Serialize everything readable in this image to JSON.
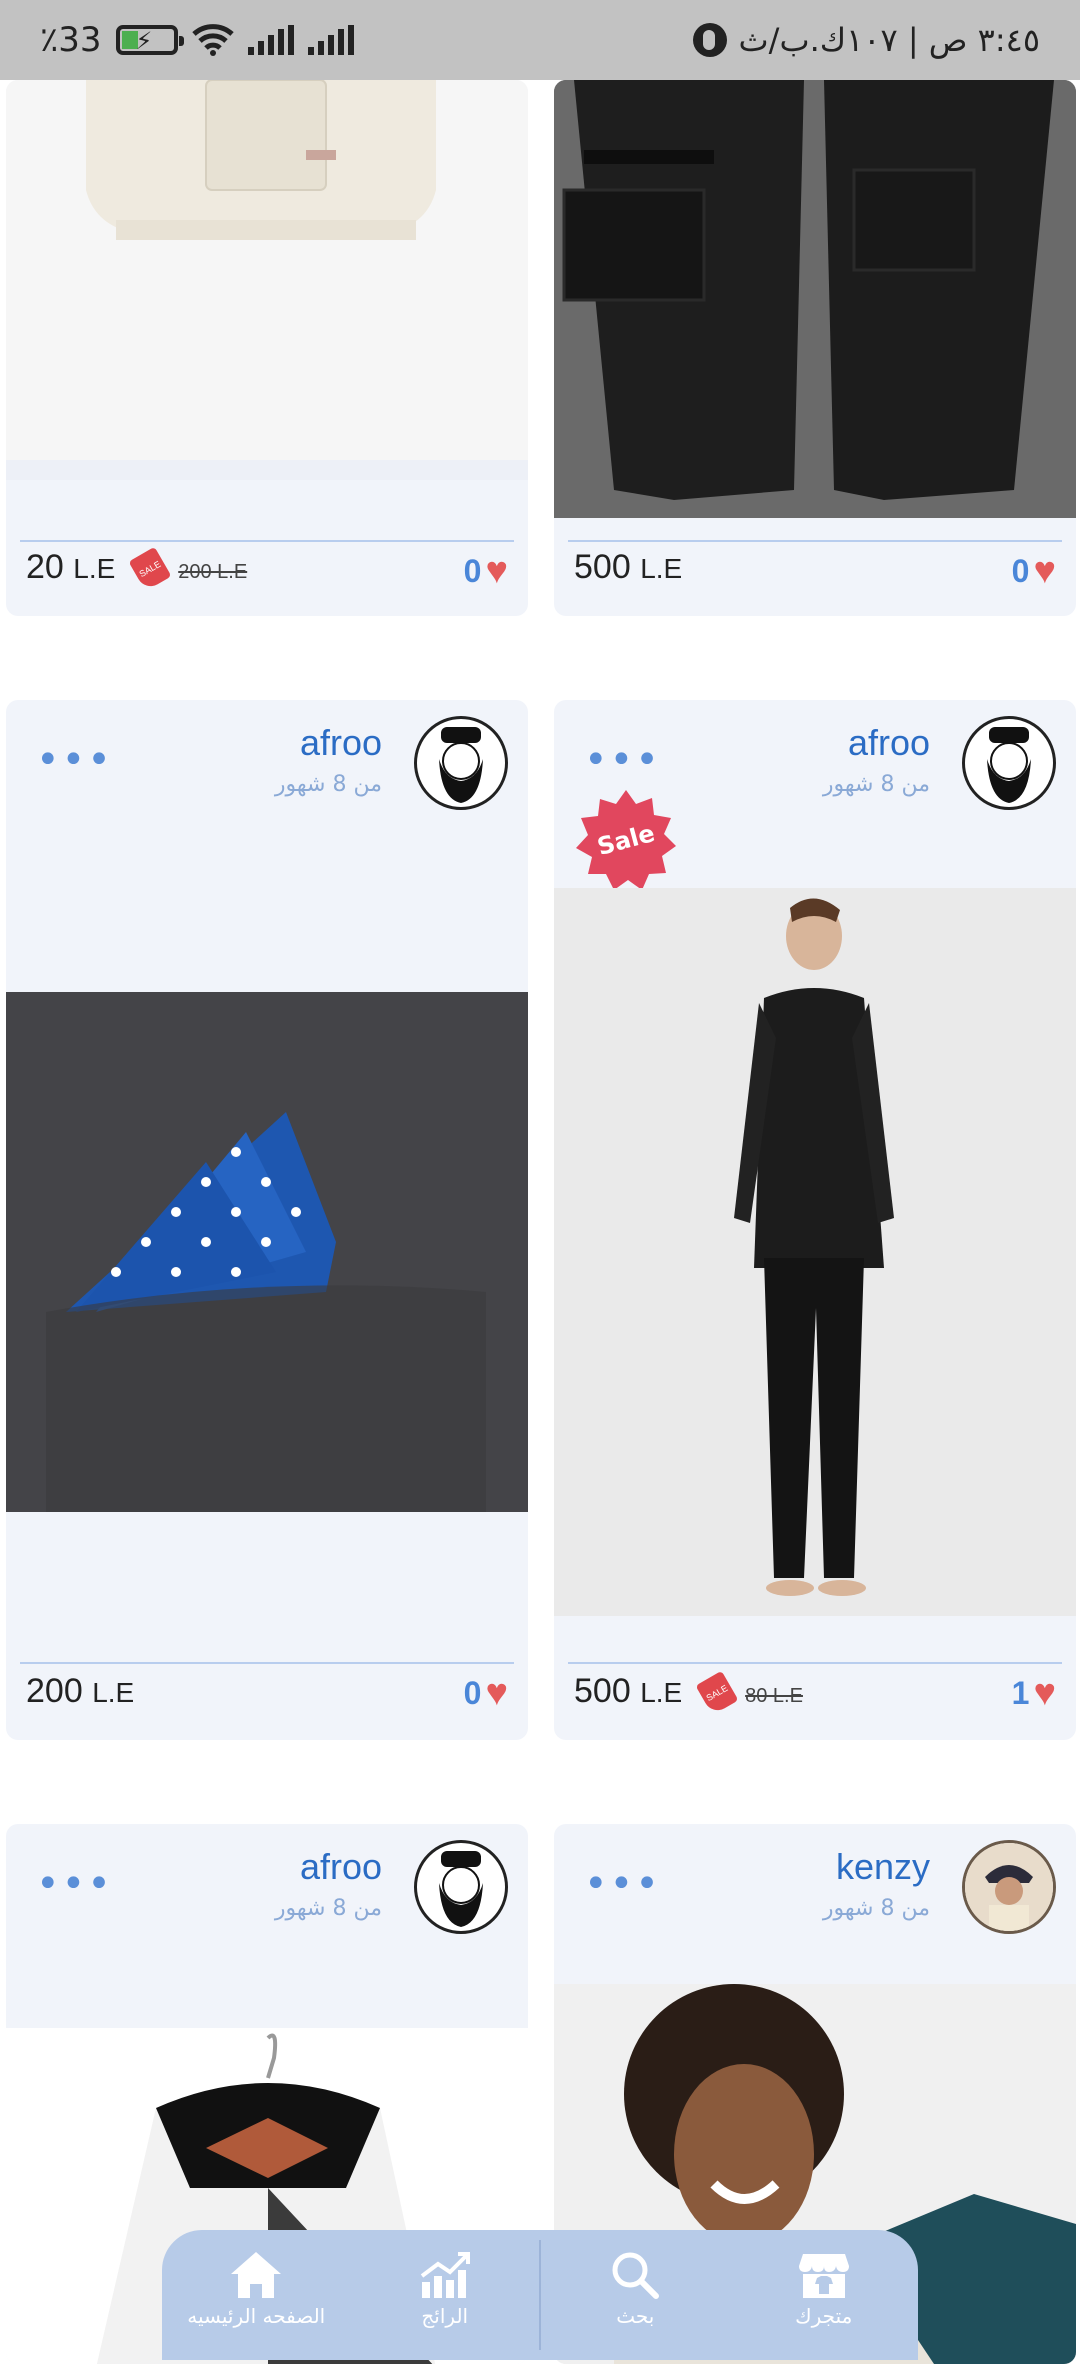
{
  "status_bar": {
    "battery_percent": "33",
    "percent_sign": "٪",
    "time": "٣:٤٥ ص | ١٠٧ك.ب/ث"
  },
  "cards": [
    {
      "price_value": "20",
      "price_currency": "L.E",
      "old_price": "200 L.E",
      "likes": "0"
    },
    {
      "price_value": "500",
      "price_currency": "L.E",
      "likes": "0"
    },
    {
      "username": "afroo",
      "time_ago": "من 8 شهور",
      "price_value": "200",
      "price_currency": "L.E",
      "likes": "0"
    },
    {
      "username": "afroo",
      "time_ago": "من 8 شهور",
      "sale_badge": "Sale",
      "price_value": "500",
      "price_currency": "L.E",
      "old_price": "80 L.E",
      "likes": "1"
    },
    {
      "username": "afroo",
      "time_ago": "من 8 شهور"
    },
    {
      "username": "kenzy",
      "time_ago": "من 8 شهور"
    }
  ],
  "sale_tag_text": "SALE",
  "bottom_nav": [
    {
      "label": "الصفحه الرئيسيه",
      "icon": "home-icon"
    },
    {
      "label": "الرائج",
      "icon": "trending-icon"
    },
    {
      "label": "بحث",
      "icon": "search-icon"
    },
    {
      "label": "متجرك",
      "icon": "store-icon"
    }
  ]
}
